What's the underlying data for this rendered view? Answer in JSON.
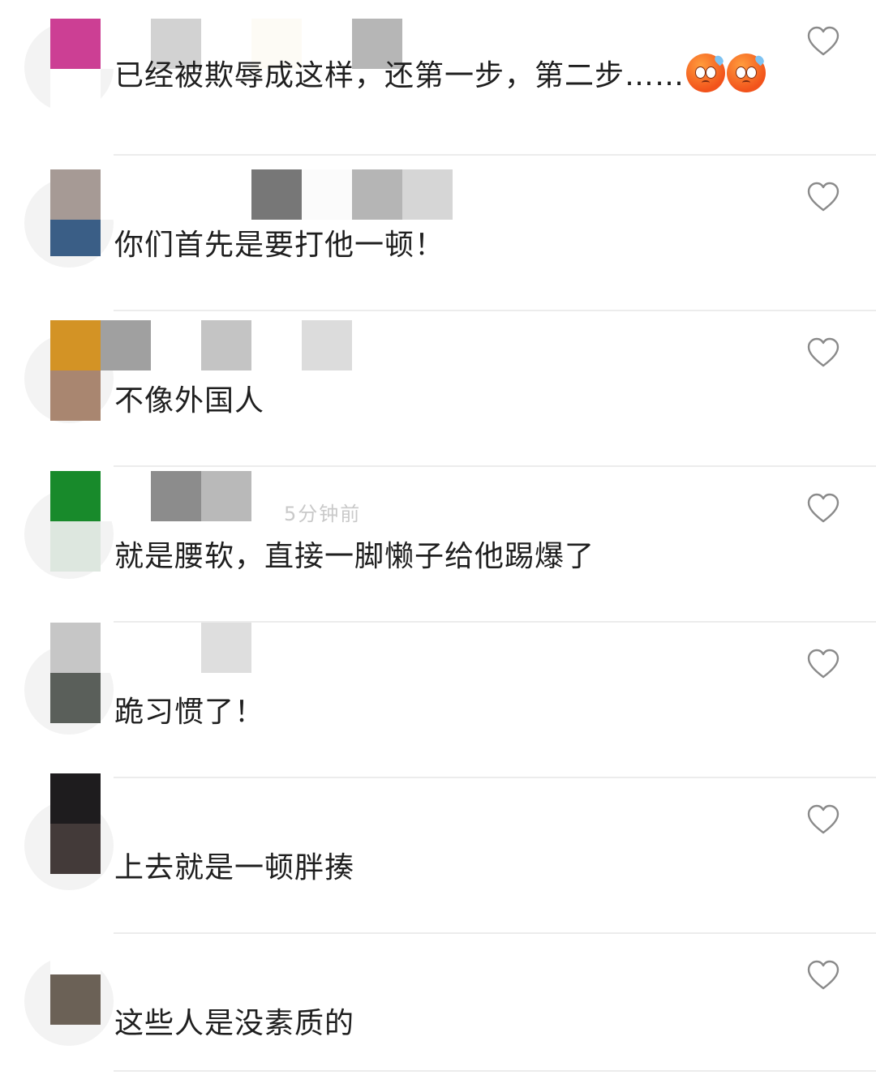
{
  "comments": [
    {
      "text": "已经被欺辱成这样，还第一步，第二步……",
      "emoji": [
        "cold-sweat-face",
        "cold-sweat-face"
      ],
      "avatar_colors": [
        "#cc3f94",
        "#ffffff"
      ],
      "name_block_colors": [
        "#ffffff",
        "#d2d2d2",
        "#ffffff",
        "#fdfbf5",
        "#ffffff",
        "#b6b6b6"
      ],
      "meta": ""
    },
    {
      "text": "你们首先是要打他一顿！",
      "emoji": [],
      "avatar_colors": [
        "#a69a95",
        "#3a5e86"
      ],
      "name_block_colors": [
        "#ffffff",
        "#ffffff",
        "#ffffff",
        "#777777",
        "#fbfbfb",
        "#b5b5b5",
        "#d6d6d6"
      ],
      "meta": ""
    },
    {
      "text": "不像外国人",
      "emoji": [],
      "avatar_colors": [
        "#d39325",
        "#a98670"
      ],
      "name_block_colors": [
        "#a0a0a0",
        "#ffffff",
        "#c4c4c4",
        "#ffffff",
        "#dcdcdc"
      ],
      "meta": ""
    },
    {
      "text": "就是腰软，直接一脚懒子给他踢爆了",
      "emoji": [],
      "avatar_colors": [
        "#188a2b",
        "#dde7df"
      ],
      "name_block_colors": [
        "#ffffff",
        "#8c8c8c",
        "#b9b9b9"
      ],
      "meta": "5分钟前"
    },
    {
      "text": "跪习惯了！",
      "emoji": [],
      "avatar_colors": [
        "#c6c6c6",
        "#5a5f5a"
      ],
      "name_block_colors": [
        "#ffffff",
        "#ffffff",
        "#dedede"
      ],
      "meta": ""
    },
    {
      "text": "上去就是一顿胖揍",
      "emoji": [],
      "avatar_colors": [
        "#1e1c1e",
        "#433a39"
      ],
      "name_block_colors": [],
      "meta": ""
    },
    {
      "text": "这些人是没素质的",
      "emoji": [],
      "avatar_colors": [
        "#ffffff",
        "#6b6156"
      ],
      "name_block_colors": [],
      "meta": ""
    }
  ],
  "icons": {
    "like": "heart-outline-icon"
  },
  "colors": {
    "text": "#1f1f1f",
    "divider": "#ececec",
    "icon": "#8a8a8a"
  }
}
